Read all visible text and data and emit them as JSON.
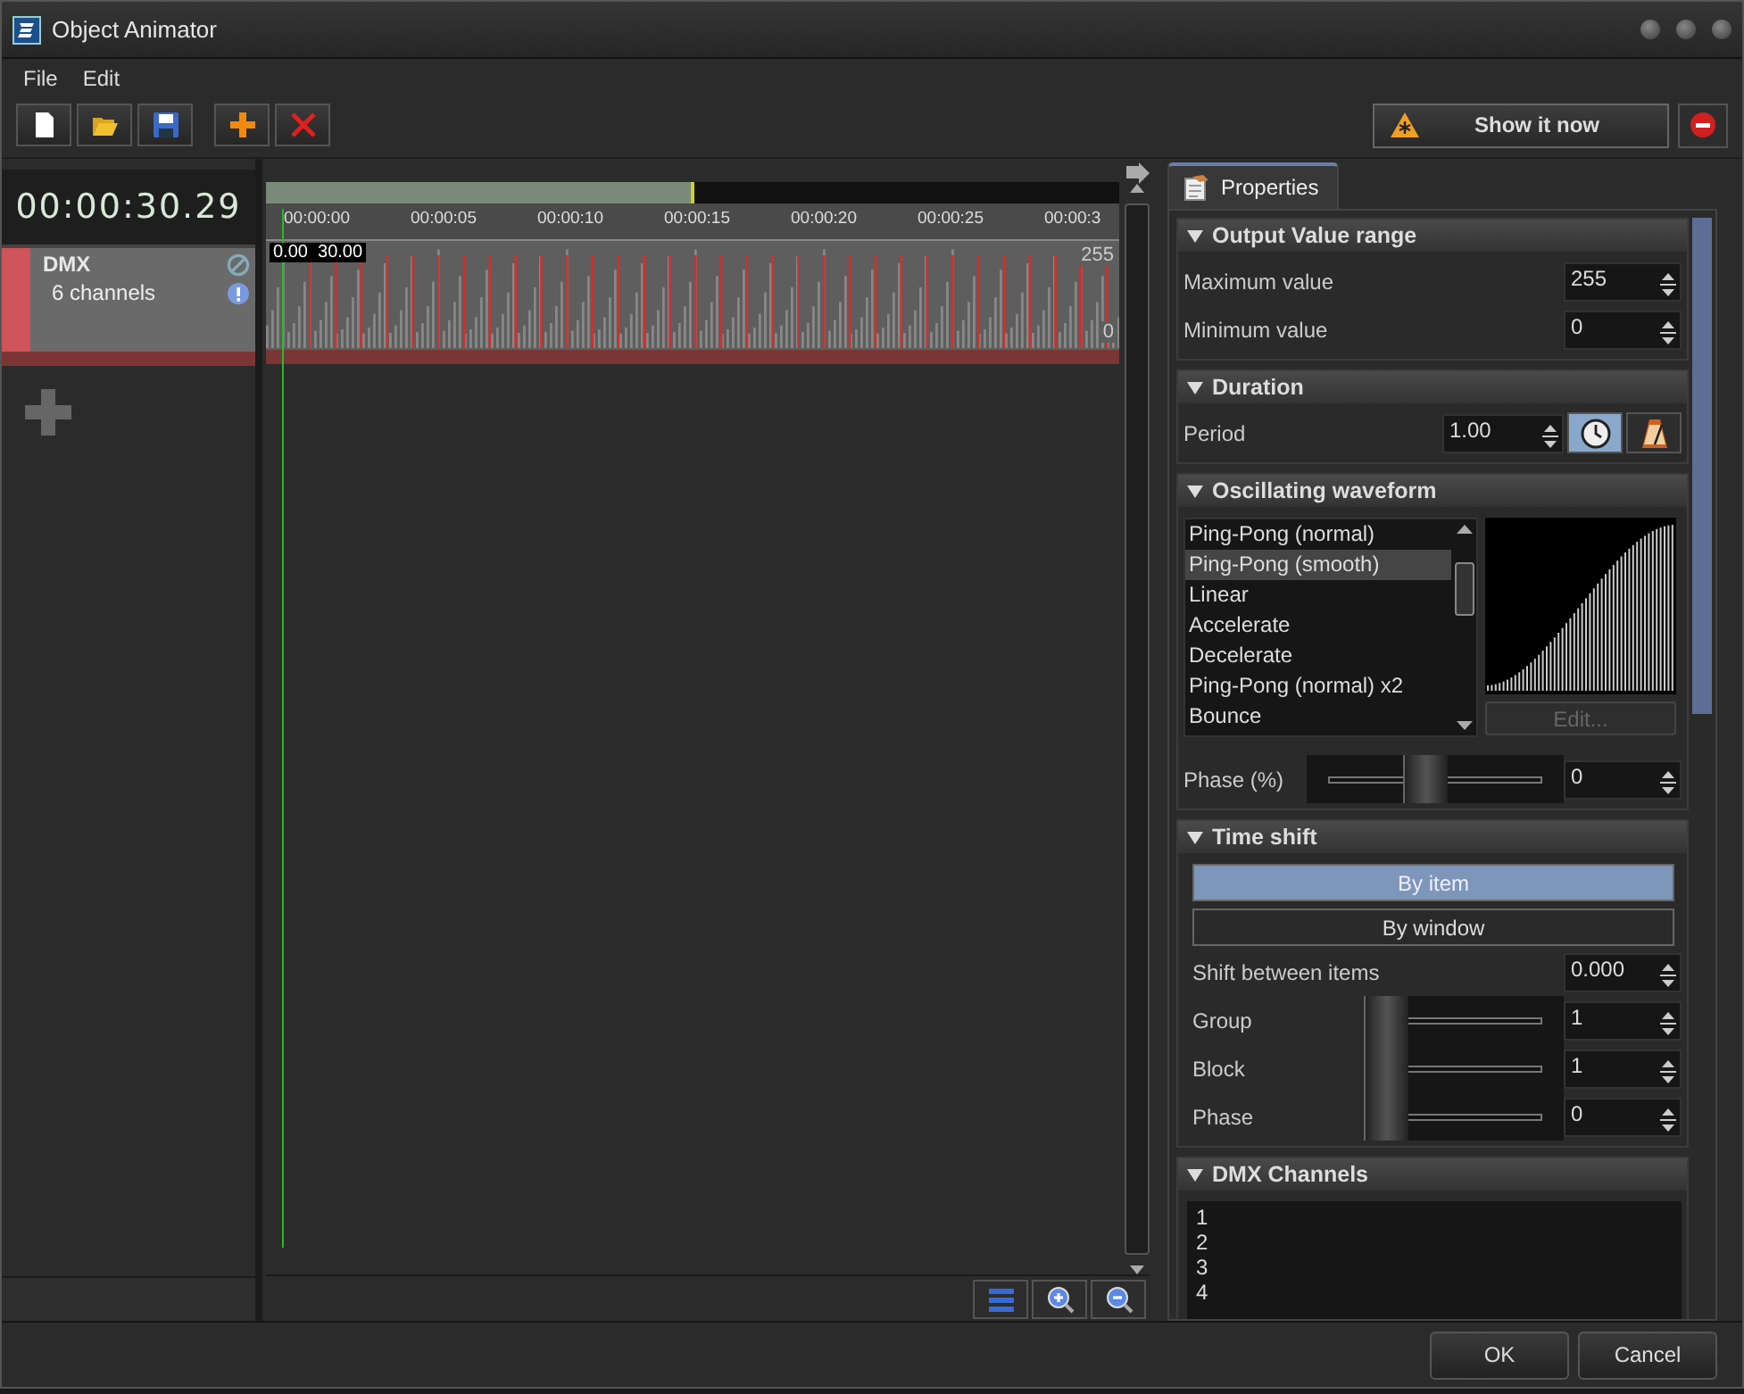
{
  "window": {
    "title": "Object Animator"
  },
  "menu": [
    {
      "label": "File"
    },
    {
      "label": "Edit"
    }
  ],
  "toolbar": [
    {
      "kind": "new"
    },
    {
      "kind": "open"
    },
    {
      "kind": "save"
    },
    {
      "kind": "separator"
    },
    {
      "kind": "add"
    },
    {
      "kind": "delete"
    }
  ],
  "show_button": {
    "label": "Show it now"
  },
  "timecode": "00:00:30.29",
  "track": {
    "name": "DMX",
    "subtitle": "6 channels"
  },
  "timeline": {
    "ruler": [
      "00:00:00",
      "00:00:05",
      "00:00:10",
      "00:00:15",
      "00:00:20",
      "00:00:25",
      "00:00:3"
    ],
    "range_start": "0.00",
    "range_end": "30.00",
    "level_max": "255",
    "level_min": "0"
  },
  "tabs": [
    {
      "label": "Properties",
      "selected": true
    }
  ],
  "sections": [
    {
      "title": "Output Value range",
      "expanded": true,
      "kind": "fields",
      "rows": [
        {
          "label": "Maximum value",
          "value": "255"
        },
        {
          "label": "Minimum value",
          "value": "0"
        }
      ]
    },
    {
      "title": "Duration",
      "expanded": true,
      "kind": "duration",
      "label": "Period",
      "value": "1.00",
      "modes": [
        {
          "kind": "clock",
          "selected": true
        },
        {
          "kind": "metronome",
          "selected": false
        }
      ]
    },
    {
      "title": "Oscillating waveform",
      "expanded": true,
      "kind": "waveform",
      "items": [
        {
          "label": "Ping-Pong (normal)",
          "selected": false
        },
        {
          "label": "Ping-Pong (smooth)",
          "selected": true
        },
        {
          "label": "Linear",
          "selected": false
        },
        {
          "label": "Accelerate",
          "selected": false
        },
        {
          "label": "Decelerate",
          "selected": false
        },
        {
          "label": "Ping-Pong (normal) x2",
          "selected": false
        },
        {
          "label": "Bounce",
          "selected": false
        }
      ],
      "edit_button": {
        "label": "Edit...",
        "disabled": true
      },
      "phase": {
        "label": "Phase (%)",
        "level": 0.45,
        "value": "0"
      }
    },
    {
      "title": "Time shift",
      "expanded": true,
      "kind": "timeshift",
      "modes": [
        {
          "label": "By item",
          "selected": true
        },
        {
          "label": "By window",
          "selected": false
        }
      ],
      "shift": {
        "label": "Shift between items",
        "value": "0.000"
      },
      "sliders": [
        {
          "label": "Group",
          "level": 0,
          "value": "1"
        },
        {
          "label": "Block",
          "level": 0,
          "value": "1"
        },
        {
          "label": "Phase",
          "level": 0,
          "value": "0"
        }
      ]
    },
    {
      "title": "DMX Channels",
      "expanded": true,
      "kind": "list",
      "items": [
        "1",
        "2",
        "3",
        "4"
      ]
    }
  ],
  "buttons": [
    {
      "label": "OK"
    },
    {
      "label": "Cancel"
    }
  ]
}
